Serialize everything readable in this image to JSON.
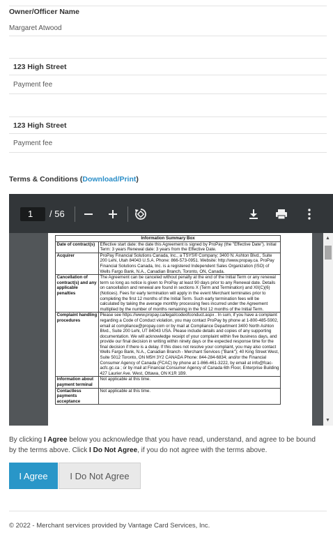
{
  "owner": {
    "label": "Owner/Officer Name",
    "value": "Margaret Atwood"
  },
  "addresses": [
    {
      "label": "123 High Street",
      "value": "Payment fee"
    },
    {
      "label": "123 High Street",
      "value": "Payment fee"
    }
  ],
  "terms": {
    "title_prefix": "Terms & Conditions (",
    "link": "Download/Print",
    "title_suffix": ")"
  },
  "pdf": {
    "page": "1",
    "total": "/ 56",
    "icons": [
      "zoom-out-icon",
      "zoom-in-icon",
      "rotate-icon",
      "download-icon",
      "print-icon",
      "more-icon"
    ],
    "doc": {
      "header": "Information Summary Box",
      "rows": [
        {
          "k": "Date of contract(s)",
          "v": "Effective start date: the date this Agreement is signed by ProPay (the \"Effective Date\"). Initial Term: 3 years Renewal date: 3 years from the Effective Date."
        },
        {
          "k": "Acquirer",
          "v": "ProPay Financial Solutions Canada, Inc., a TSYS® Company; 3400 N. Ashton Blvd., Suite 200 Lehi, Utah 84043 U.S.A. Phone: 866-573-0951. Website: http://www.propay.ca. ProPay Financial Solutions Canada, Inc. is a registered Independent Sales Organization (ISO) of Wells Fargo Bank, N.A., Canadian Branch, Toronto, ON, Canada."
        },
        {
          "k": "Cancellation of contract(s) and any applicable penalties",
          "v": "The Agreement can be canceled without penalty at the end of the Initial Term or any renewal term so long as notice is given to ProPay at least 90 days prior to any Renewal date. Details on cancellation and renewal are found in sections X (Term and Termination) and XII(C)(6) (Notices). Fees for early termination will apply in the event Merchant terminates prior to completing the first 12 months of the Initial Term. Such early termination fees will be calculated by taking the average monthly processing fees incurred under the Agreement multiplied by the number of months remaining in the first 12 months of the Initial Term."
        },
        {
          "k": "Complaint handling procedures",
          "v": "Please see https://www.propay.ca/legal/codeofconduct.aspx . In sum, if you have a complaint regarding a Code of Conduct violation, you may contact ProPay by phone at 1-800-485-5902, email at compliance@propay.com or by mail at Compliance Department 3400 North Ashton Blvd., Suite 200 Lehi, UT 84043 USA. Please include details and copies of any supporting documentation. We will acknowledge receipt of your complaint within five business days, and provide our final decision in writing within ninety days or the expected response time for the final decision if there is a delay. If this does not resolve your complaint, you may also contact Wells Fargo Bank, N.A., Canadian Branch - Merchant Services (\"Bank\"); 40 King Street West, Suite 5012 Toronto, ON M5H 3Y2 CANADA Phone: 844-284-6834; and/or the Financial Consumer Agency of Canada (FCAC) by phone at 1-866-461-3222, by email at info@fcac-acfc.gc.ca ; or by mail at Financial Consumer Agency of Canada 6th Floor, Enterprise Building 427 Laurier Ave. West, Ottawa, ON K1R 1B9."
        },
        {
          "k": "Information about payment terminal",
          "v": "Not applicable at this time."
        },
        {
          "k": "Contactless payments acceptance",
          "v": "Not applicable at this time."
        }
      ]
    }
  },
  "agreement": {
    "p1": "By clicking ",
    "b1": "I Agree",
    "p2": " below you acknowledge that you have read, understand, and agree to be bound by the terms above. Click ",
    "b2": "I Do Not Agree",
    "p3": ", if you do not agree with the terms above."
  },
  "buttons": {
    "agree": "I Agree",
    "disagree": "I Do Not Agree"
  },
  "footer": "© 2022 - Merchant services provided by Vantage Card Services, Inc.",
  "colors": {
    "accent": "#2996c8",
    "toolbar": "#323639",
    "viewer_bg": "#525659"
  }
}
